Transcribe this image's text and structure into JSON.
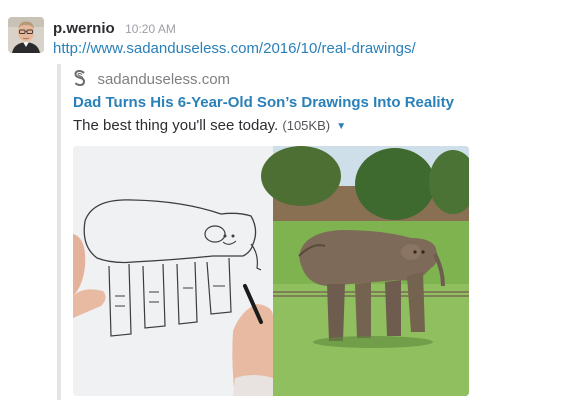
{
  "message": {
    "username": "p.wernio",
    "timestamp": "10:20 AM",
    "link": "http://www.sadanduseless.com/2016/10/real-drawings/"
  },
  "attachment": {
    "service_name": "sadanduseless.com",
    "title": "Dad Turns His 6-Year-Old Son’s Drawings Into Reality",
    "text": "The best thing you'll see today.",
    "size": "(105KB)",
    "caret_icon": "caret-down-icon"
  },
  "colors": {
    "link": "#2a80b9",
    "username": "#2c2d30",
    "timestamp": "#9e9ea6",
    "attachment_border": "#e3e4e6"
  }
}
